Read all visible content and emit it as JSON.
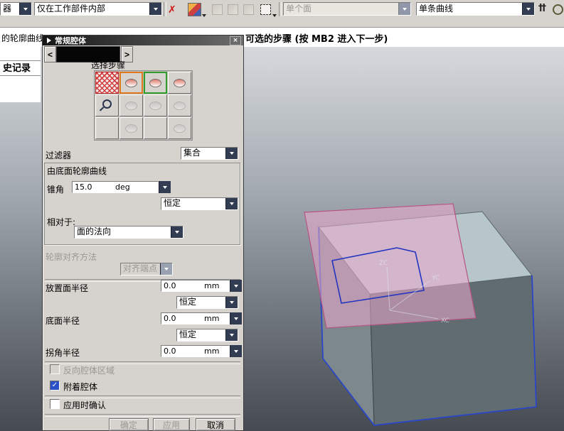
{
  "toolbar": {
    "filter_combo": "器",
    "scope_combo": "仅在工作部件内部",
    "face_rule_combo": "单个面",
    "curve_rule_combo": "单条曲线",
    "clear_glyph": "✗",
    "chain_glyph": "††"
  },
  "prompt": {
    "left": "的轮廓曲线",
    "center": "可选的步骤 (按 MB2 进入下一步)"
  },
  "resource": {
    "history": "史记录"
  },
  "dialog": {
    "title": "常规腔体",
    "close_glyph": "×",
    "back_glyph": "<",
    "forward_glyph": ">",
    "steps_label": "选择步骤",
    "filter": {
      "label": "过滤器",
      "value": "集合"
    },
    "profile_group": {
      "title": "由底面轮廓曲线",
      "taper": {
        "label": "锥角",
        "value": "15.0",
        "unit": "deg"
      },
      "law": "恒定",
      "relative": {
        "label": "相对于:",
        "value": "面的法向"
      }
    },
    "align": {
      "label": "轮廓对齐方法",
      "value": "对齐端点"
    },
    "placement_radius": {
      "label": "放置面半径",
      "value": "0.0",
      "unit": "mm",
      "law": "恒定"
    },
    "bottom_radius": {
      "label": "底面半径",
      "value": "0.0",
      "unit": "mm",
      "law": "恒定"
    },
    "corner_radius": {
      "label": "拐角半径",
      "value": "0.0",
      "unit": "mm"
    },
    "checks": {
      "reverse": {
        "label": "反向腔体区域",
        "checked": false
      },
      "attach": {
        "label": "附着腔体",
        "checked": true,
        "glyph": "✓"
      },
      "confirm": {
        "label": "应用时确认",
        "checked": false
      }
    },
    "buttons": {
      "ok": "确定",
      "apply": "应用",
      "cancel": "取消"
    }
  },
  "viewport": {
    "axes": {
      "x": "XC",
      "y": "YC",
      "z": "ZC"
    }
  },
  "colors": {
    "accent_navy": "#323c52",
    "selection_orange": "#e07820",
    "selection_green": "#2f9e2f",
    "hatch_red": "#d23c3c",
    "datum_pink": "#ecaacd",
    "sketch_blue": "#2133c0",
    "edge_blue": "#2a46c8",
    "dialog_bg": "#d6d3ce"
  }
}
